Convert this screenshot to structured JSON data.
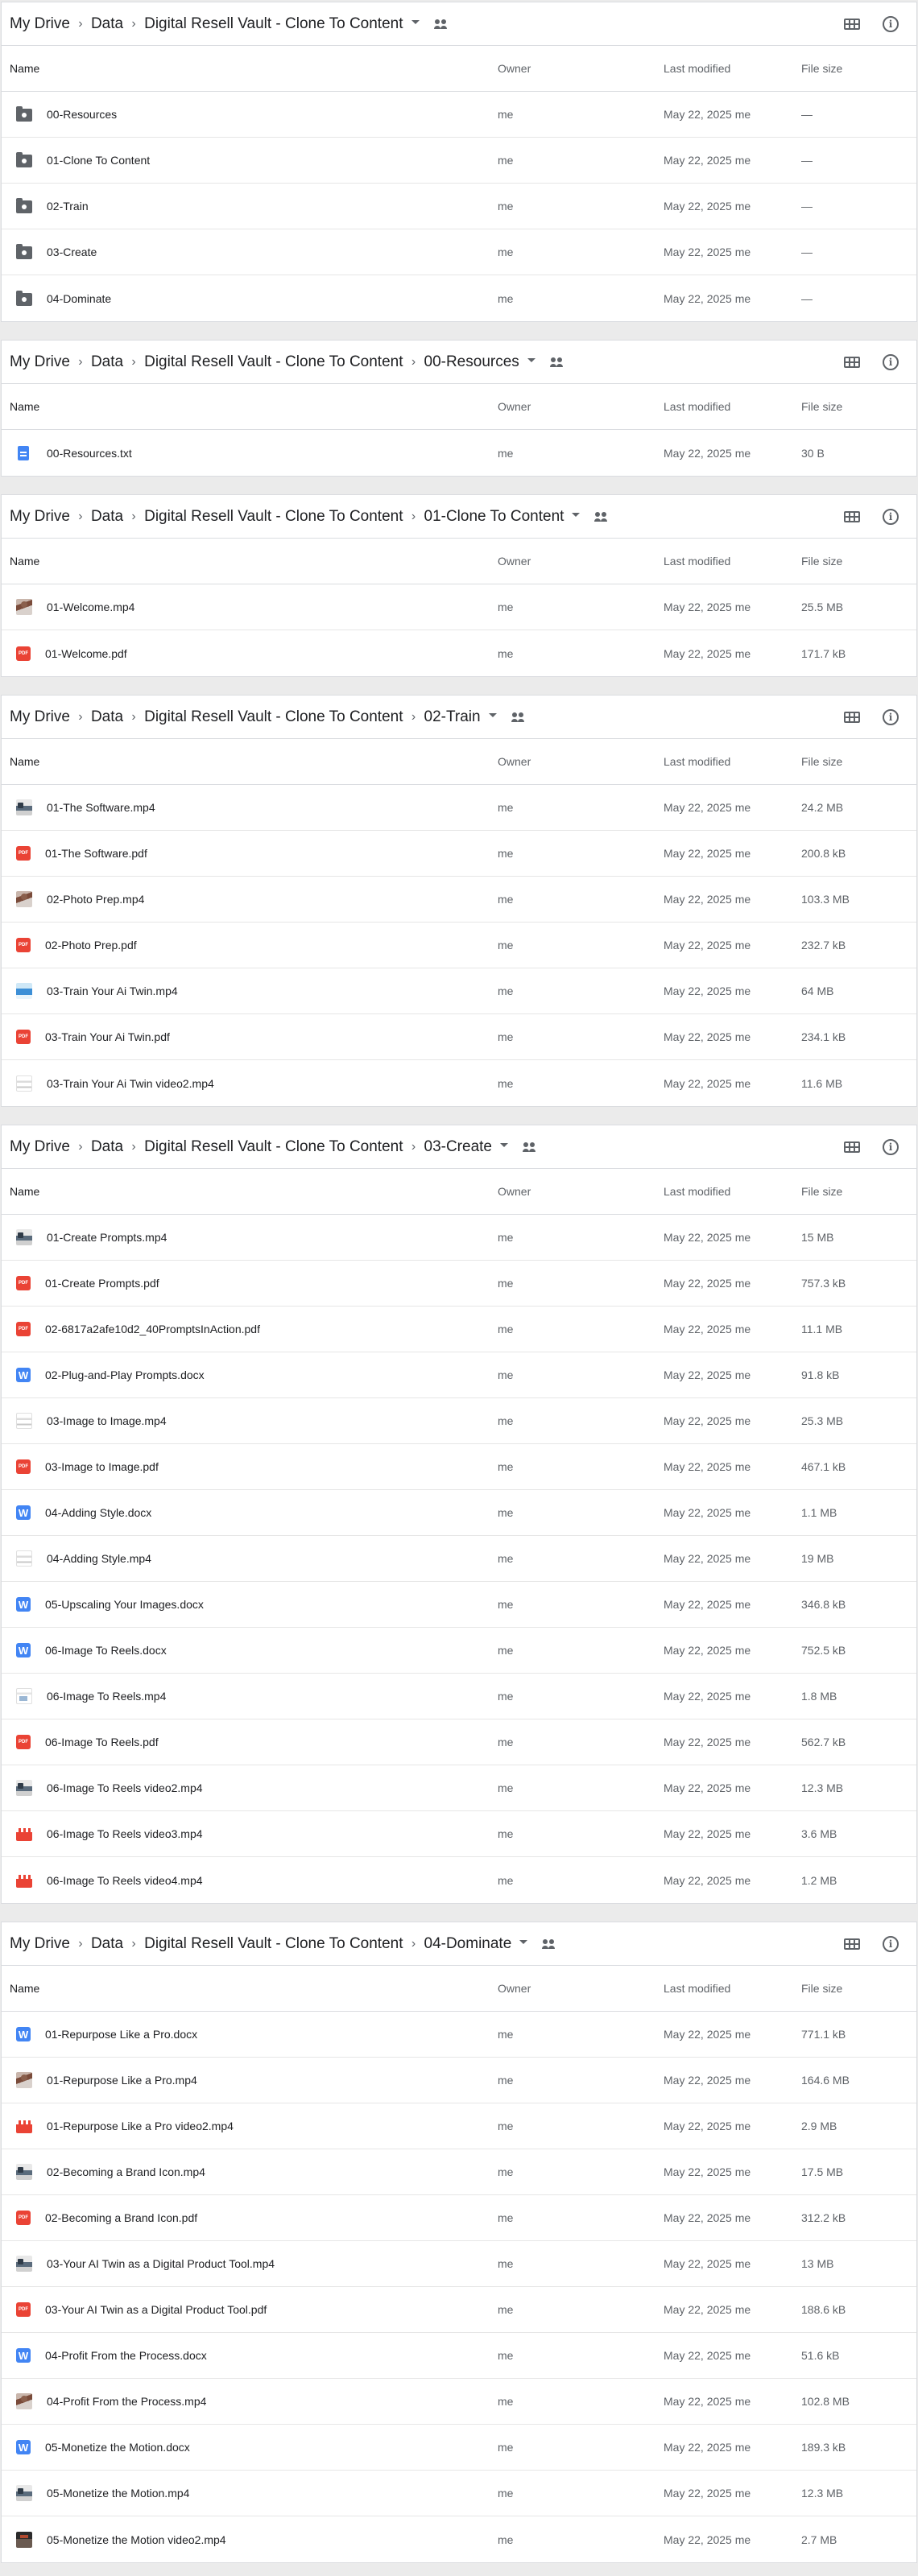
{
  "columns": {
    "name": "Name",
    "owner": "Owner",
    "modified": "Last modified",
    "size": "File size"
  },
  "sections": [
    {
      "crumbs": [
        "My Drive",
        "Data",
        "Digital Resell Vault - Clone To Content"
      ],
      "rows": [
        {
          "icon": "folder-shared-icon",
          "name": "00-Resources",
          "owner": "me",
          "modified": "May 22, 2025 me",
          "size": "—"
        },
        {
          "icon": "folder-shared-icon",
          "name": "01-Clone To Content",
          "owner": "me",
          "modified": "May 22, 2025 me",
          "size": "—"
        },
        {
          "icon": "folder-shared-icon",
          "name": "02-Train",
          "owner": "me",
          "modified": "May 22, 2025 me",
          "size": "—"
        },
        {
          "icon": "folder-shared-icon",
          "name": "03-Create",
          "owner": "me",
          "modified": "May 22, 2025 me",
          "size": "—"
        },
        {
          "icon": "folder-shared-icon",
          "name": "04-Dominate",
          "owner": "me",
          "modified": "May 22, 2025 me",
          "size": "—"
        }
      ]
    },
    {
      "crumbs": [
        "My Drive",
        "Data",
        "Digital Resell Vault - Clone To Content",
        "00-Resources"
      ],
      "rows": [
        {
          "icon": "text-file-icon",
          "name": "00-Resources.txt",
          "owner": "me",
          "modified": "May 22, 2025 me",
          "size": "30 B"
        }
      ]
    },
    {
      "crumbs": [
        "My Drive",
        "Data",
        "Digital Resell Vault - Clone To Content",
        "01-Clone To Content"
      ],
      "rows": [
        {
          "icon": "video-thumb-person-icon",
          "name": "01-Welcome.mp4",
          "owner": "me",
          "modified": "May 22, 2025 me",
          "size": "25.5 MB"
        },
        {
          "icon": "pdf-icon",
          "name": "01-Welcome.pdf",
          "owner": "me",
          "modified": "May 22, 2025 me",
          "size": "171.7 kB"
        }
      ]
    },
    {
      "crumbs": [
        "My Drive",
        "Data",
        "Digital Resell Vault - Clone To Content",
        "02-Train"
      ],
      "rows": [
        {
          "icon": "video-thumb-desk-icon",
          "name": "01-The Software.mp4",
          "owner": "me",
          "modified": "May 22, 2025 me",
          "size": "24.2 MB"
        },
        {
          "icon": "pdf-icon",
          "name": "01-The Software.pdf",
          "owner": "me",
          "modified": "May 22, 2025 me",
          "size": "200.8 kB"
        },
        {
          "icon": "video-thumb-person-icon",
          "name": "02-Photo Prep.mp4",
          "owner": "me",
          "modified": "May 22, 2025 me",
          "size": "103.3 MB"
        },
        {
          "icon": "pdf-icon",
          "name": "02-Photo Prep.pdf",
          "owner": "me",
          "modified": "May 22, 2025 me",
          "size": "232.7 kB"
        },
        {
          "icon": "video-thumb-blue-icon",
          "name": "03-Train Your Ai Twin.mp4",
          "owner": "me",
          "modified": "May 22, 2025 me",
          "size": "64 MB"
        },
        {
          "icon": "pdf-icon",
          "name": "03-Train Your Ai Twin.pdf",
          "owner": "me",
          "modified": "May 22, 2025 me",
          "size": "234.1 kB"
        },
        {
          "icon": "video-thumb-light-icon",
          "name": "03-Train Your Ai Twin video2.mp4",
          "owner": "me",
          "modified": "May 22, 2025 me",
          "size": "11.6 MB"
        }
      ]
    },
    {
      "crumbs": [
        "My Drive",
        "Data",
        "Digital Resell Vault - Clone To Content",
        "03-Create"
      ],
      "rows": [
        {
          "icon": "video-thumb-desk-icon",
          "name": "01-Create Prompts.mp4",
          "owner": "me",
          "modified": "May 22, 2025 me",
          "size": "15 MB"
        },
        {
          "icon": "pdf-icon",
          "name": "01-Create Prompts.pdf",
          "owner": "me",
          "modified": "May 22, 2025 me",
          "size": "757.3 kB"
        },
        {
          "icon": "pdf-icon",
          "name": "02-6817a2afe10d2_40PromptsInAction.pdf",
          "owner": "me",
          "modified": "May 22, 2025 me",
          "size": "11.1 MB"
        },
        {
          "icon": "word-doc-icon",
          "name": "02-Plug-and-Play Prompts.docx",
          "owner": "me",
          "modified": "May 22, 2025 me",
          "size": "91.8 kB"
        },
        {
          "icon": "video-thumb-light-icon",
          "name": "03-Image to Image.mp4",
          "owner": "me",
          "modified": "May 22, 2025 me",
          "size": "25.3 MB"
        },
        {
          "icon": "pdf-icon",
          "name": "03-Image to Image.pdf",
          "owner": "me",
          "modified": "May 22, 2025 me",
          "size": "467.1 kB"
        },
        {
          "icon": "word-doc-icon",
          "name": "04-Adding Style.docx",
          "owner": "me",
          "modified": "May 22, 2025 me",
          "size": "1.1 MB"
        },
        {
          "icon": "video-thumb-light-icon",
          "name": "04-Adding Style.mp4",
          "owner": "me",
          "modified": "May 22, 2025 me",
          "size": "19 MB"
        },
        {
          "icon": "word-doc-icon",
          "name": "05-Upscaling Your Images.docx",
          "owner": "me",
          "modified": "May 22, 2025 me",
          "size": "346.8 kB"
        },
        {
          "icon": "word-doc-icon",
          "name": "06-Image To Reels.docx",
          "owner": "me",
          "modified": "May 22, 2025 me",
          "size": "752.5 kB"
        },
        {
          "icon": "video-thumb-light2-icon",
          "name": "06-Image To Reels.mp4",
          "owner": "me",
          "modified": "May 22, 2025 me",
          "size": "1.8 MB"
        },
        {
          "icon": "pdf-icon",
          "name": "06-Image To Reels.pdf",
          "owner": "me",
          "modified": "May 22, 2025 me",
          "size": "562.7 kB"
        },
        {
          "icon": "video-thumb-desk-icon",
          "name": "06-Image To Reels video2.mp4",
          "owner": "me",
          "modified": "May 22, 2025 me",
          "size": "12.3 MB"
        },
        {
          "icon": "video-clapper-icon",
          "name": "06-Image To Reels video3.mp4",
          "owner": "me",
          "modified": "May 22, 2025 me",
          "size": "3.6 MB"
        },
        {
          "icon": "video-clapper-icon",
          "name": "06-Image To Reels video4.mp4",
          "owner": "me",
          "modified": "May 22, 2025 me",
          "size": "1.2 MB"
        }
      ]
    },
    {
      "crumbs": [
        "My Drive",
        "Data",
        "Digital Resell Vault - Clone To Content",
        "04-Dominate"
      ],
      "rows": [
        {
          "icon": "word-doc-icon",
          "name": "01-Repurpose Like a Pro.docx",
          "owner": "me",
          "modified": "May 22, 2025 me",
          "size": "771.1 kB"
        },
        {
          "icon": "video-thumb-person-icon",
          "name": "01-Repurpose Like a Pro.mp4",
          "owner": "me",
          "modified": "May 22, 2025 me",
          "size": "164.6 MB"
        },
        {
          "icon": "video-clapper-icon",
          "name": "01-Repurpose Like a Pro video2.mp4",
          "owner": "me",
          "modified": "May 22, 2025 me",
          "size": "2.9 MB"
        },
        {
          "icon": "video-thumb-desk-icon",
          "name": "02-Becoming a Brand Icon.mp4",
          "owner": "me",
          "modified": "May 22, 2025 me",
          "size": "17.5 MB"
        },
        {
          "icon": "pdf-icon",
          "name": "02-Becoming a Brand Icon.pdf",
          "owner": "me",
          "modified": "May 22, 2025 me",
          "size": "312.2 kB"
        },
        {
          "icon": "video-thumb-desk-icon",
          "name": "03-Your AI Twin as a Digital Product Tool.mp4",
          "owner": "me",
          "modified": "May 22, 2025 me",
          "size": "13 MB"
        },
        {
          "icon": "pdf-icon",
          "name": "03-Your AI Twin as a Digital Product Tool.pdf",
          "owner": "me",
          "modified": "May 22, 2025 me",
          "size": "188.6 kB"
        },
        {
          "icon": "word-doc-icon",
          "name": "04-Profit From the Process.docx",
          "owner": "me",
          "modified": "May 22, 2025 me",
          "size": "51.6 kB"
        },
        {
          "icon": "video-thumb-person-icon",
          "name": "04-Profit From the Process.mp4",
          "owner": "me",
          "modified": "May 22, 2025 me",
          "size": "102.8 MB"
        },
        {
          "icon": "word-doc-icon",
          "name": "05-Monetize the Motion.docx",
          "owner": "me",
          "modified": "May 22, 2025 me",
          "size": "189.3 kB"
        },
        {
          "icon": "video-thumb-desk-icon",
          "name": "05-Monetize the Motion.mp4",
          "owner": "me",
          "modified": "May 22, 2025 me",
          "size": "12.3 MB"
        },
        {
          "icon": "video-thumb-dark-icon",
          "name": "05-Monetize the Motion video2.mp4",
          "owner": "me",
          "modified": "May 22, 2025 me",
          "size": "2.7 MB"
        }
      ]
    }
  ],
  "glyphs": {
    "pdf": "PDF",
    "doc": "W",
    "info": "i"
  }
}
